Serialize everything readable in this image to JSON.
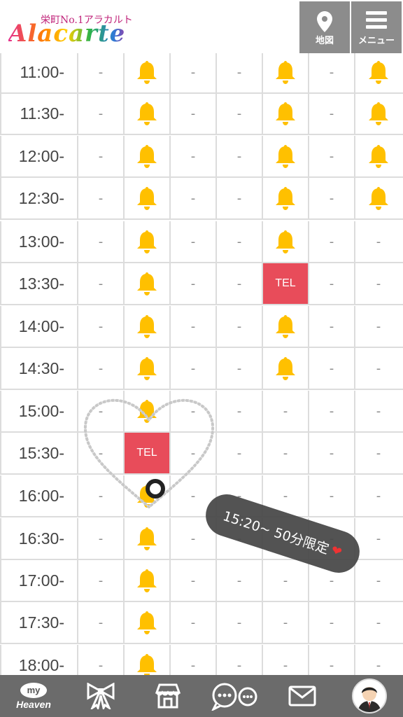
{
  "header": {
    "logo_sub": "栄町No.1アラカルト",
    "logo_main": "Alacarte",
    "map_label": "地図",
    "menu_label": "メニュー"
  },
  "schedule": {
    "rows": [
      {
        "time": "11:00-",
        "slots": [
          "-",
          "bell",
          "-",
          "-",
          "bell",
          "-",
          "bell"
        ]
      },
      {
        "time": "11:30-",
        "slots": [
          "-",
          "bell",
          "-",
          "-",
          "bell",
          "-",
          "bell"
        ]
      },
      {
        "time": "12:00-",
        "slots": [
          "-",
          "bell",
          "-",
          "-",
          "bell",
          "-",
          "bell"
        ]
      },
      {
        "time": "12:30-",
        "slots": [
          "-",
          "bell",
          "-",
          "-",
          "bell",
          "-",
          "bell"
        ]
      },
      {
        "time": "13:00-",
        "slots": [
          "-",
          "bell",
          "-",
          "-",
          "bell",
          "-",
          "-"
        ]
      },
      {
        "time": "13:30-",
        "slots": [
          "-",
          "bell",
          "-",
          "-",
          "TEL",
          "-",
          "-"
        ]
      },
      {
        "time": "14:00-",
        "slots": [
          "-",
          "bell",
          "-",
          "-",
          "bell",
          "-",
          "-"
        ]
      },
      {
        "time": "14:30-",
        "slots": [
          "-",
          "bell",
          "-",
          "-",
          "bell",
          "-",
          "-"
        ]
      },
      {
        "time": "15:00-",
        "slots": [
          "-",
          "bell",
          "-",
          "-",
          "-",
          "-",
          "-"
        ]
      },
      {
        "time": "15:30-",
        "slots": [
          "-",
          "TEL",
          "-",
          "-",
          "-",
          "-",
          "-"
        ]
      },
      {
        "time": "16:00-",
        "slots": [
          "-",
          "bell",
          "-",
          "-",
          "-",
          "-",
          "-"
        ]
      },
      {
        "time": "16:30-",
        "slots": [
          "-",
          "bell",
          "-",
          "-",
          "-",
          "-",
          "-"
        ]
      },
      {
        "time": "17:00-",
        "slots": [
          "-",
          "bell",
          "-",
          "-",
          "-",
          "-",
          "-"
        ]
      },
      {
        "time": "17:30-",
        "slots": [
          "-",
          "bell",
          "-",
          "-",
          "-",
          "-",
          "-"
        ]
      },
      {
        "time": "18:00-",
        "slots": [
          "-",
          "bell",
          "-",
          "-",
          "-",
          "-",
          "-"
        ]
      }
    ]
  },
  "promo": {
    "text": "15:20~ 50分限定",
    "icon": "heart-icon"
  },
  "bottom_nav": {
    "my_label": "my",
    "heaven_label": "Heaven",
    "items": [
      "myheaven",
      "ribbon-icon",
      "shop-icon",
      "chat-icon",
      "mail-icon",
      "avatar"
    ]
  },
  "colors": {
    "bell": "#ffc000",
    "tel": "#e84c5a",
    "header_button": "#8c8c8c",
    "bottom_bar": "#6b6b6b"
  }
}
